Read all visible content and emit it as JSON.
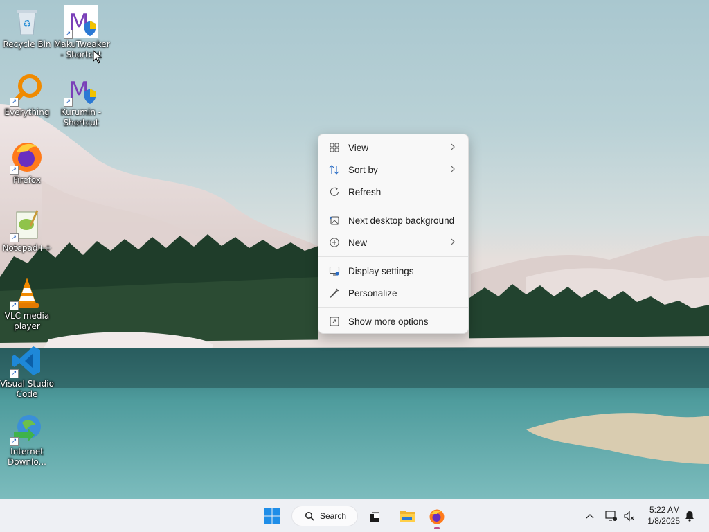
{
  "desktop_icons": [
    {
      "label": "Recycle Bin",
      "icon": "recycle-bin-icon"
    },
    {
      "label": "MakuTweaker - Shortcut",
      "icon": "makutweaker-icon"
    },
    {
      "label": "Everything",
      "icon": "everything-search-icon"
    },
    {
      "label": "Kurumin - Shortcut",
      "icon": "kurumin-icon"
    },
    {
      "label": "Firefox",
      "icon": "firefox-icon"
    },
    {
      "label": "Notepad++",
      "icon": "notepad-plus-plus-icon"
    },
    {
      "label": "VLC media player",
      "icon": "vlc-icon"
    },
    {
      "label": "Visual Studio Code",
      "icon": "vscode-icon"
    },
    {
      "label": "Internet Downlo...",
      "icon": "internet-download-manager-icon"
    }
  ],
  "context_menu": {
    "items": [
      {
        "label": "View",
        "icon": "grid-view-icon",
        "submenu": true
      },
      {
        "label": "Sort by",
        "icon": "sort-icon",
        "submenu": true
      },
      {
        "label": "Refresh",
        "icon": "refresh-icon",
        "submenu": false
      },
      {
        "label": "Next desktop background",
        "icon": "next-background-icon",
        "submenu": false
      },
      {
        "label": "New",
        "icon": "add-circle-icon",
        "submenu": true
      },
      {
        "label": "Display settings",
        "icon": "display-settings-icon",
        "submenu": false
      },
      {
        "label": "Personalize",
        "icon": "pen-icon",
        "submenu": false
      },
      {
        "label": "Show more options",
        "icon": "show-more-options-icon",
        "submenu": false
      }
    ]
  },
  "taskbar": {
    "search_label": "Search",
    "apps": [
      "start-icon",
      "task-view-icon",
      "file-explorer-icon",
      "firefox-icon"
    ],
    "tray": {
      "time": "5:22 AM",
      "date": "1/8/2025"
    }
  }
}
